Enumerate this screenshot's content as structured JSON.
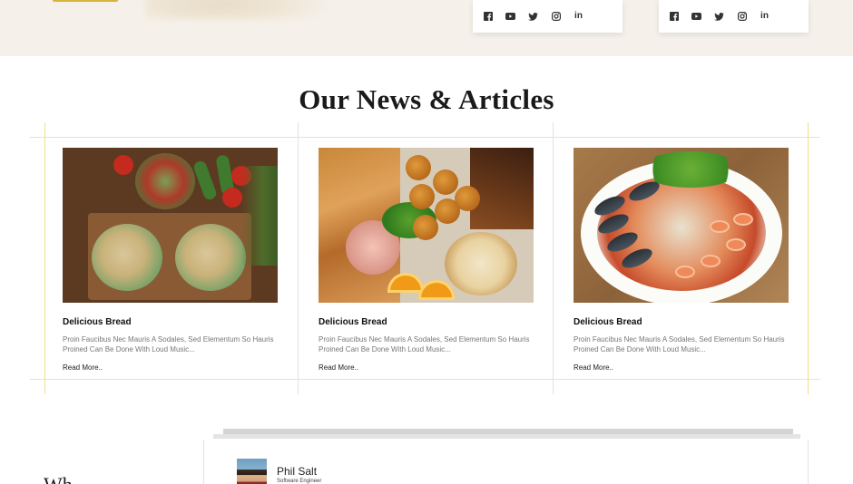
{
  "colors": {
    "accent": "#d9b43a",
    "band": "#f5f1ea",
    "grid_line": "#e2e2e2",
    "gold_line": "#f0e08a"
  },
  "social_cards": [
    {
      "icons": [
        "facebook-icon",
        "youtube-icon",
        "twitter-icon",
        "instagram-icon",
        "linkedin-icon"
      ],
      "linkedin_text": "in"
    },
    {
      "icons": [
        "facebook-icon",
        "youtube-icon",
        "twitter-icon",
        "instagram-icon",
        "linkedin-icon"
      ],
      "linkedin_text": "in"
    }
  ],
  "news": {
    "title": "Our News & Articles",
    "articles": [
      {
        "title": "Delicious Bread",
        "description": "Proin Faucibus Nec Mauris A Sodales, Sed Elementum So Hauris Proined Can Be Done With Loud Music...",
        "read_more": "Read More.."
      },
      {
        "title": "Delicious Bread",
        "description": "Proin Faucibus Nec Mauris A Sodales, Sed Elementum So Hauris Proined Can Be Done With Loud Music...",
        "read_more": "Read More.."
      },
      {
        "title": "Delicious Bread",
        "description": "Proin Faucibus Nec Mauris A Sodales, Sed Elementum So Hauris Proined Can Be Done With Loud Music...",
        "read_more": "Read More.."
      }
    ]
  },
  "testimonial": {
    "name": "Phil Salt",
    "role": "Software Engineer",
    "left_heading": "Wh"
  }
}
